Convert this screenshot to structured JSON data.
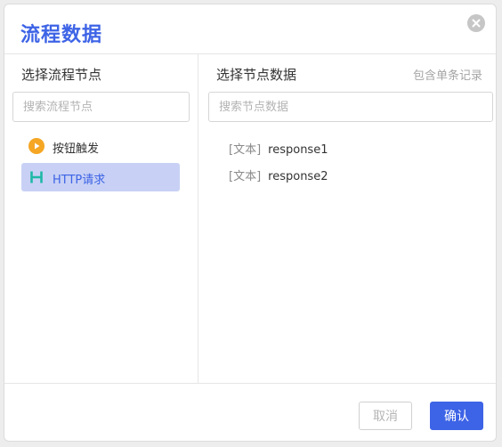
{
  "dialog": {
    "title": "流程数据"
  },
  "left_panel": {
    "heading": "选择流程节点",
    "search_placeholder": "搜索流程节点",
    "nodes": [
      {
        "label": "按钮触发",
        "icon": "play-circle-icon",
        "icon_color": "#f5a623",
        "selected": false
      },
      {
        "label": "HTTP请求",
        "icon": "http-h-icon",
        "icon_color": "#1fb8a6",
        "selected": true
      }
    ]
  },
  "right_panel": {
    "heading": "选择节点数据",
    "hint": "包含单条记录",
    "search_placeholder": "搜索节点数据",
    "fields": [
      {
        "type": "[文本]",
        "name": "response1"
      },
      {
        "type": "[文本]",
        "name": "response2"
      }
    ]
  },
  "footer": {
    "cancel_label": "取消",
    "confirm_label": "确认"
  },
  "colors": {
    "accent": "#3d63e6",
    "selected_bg": "#c8d1f5"
  }
}
